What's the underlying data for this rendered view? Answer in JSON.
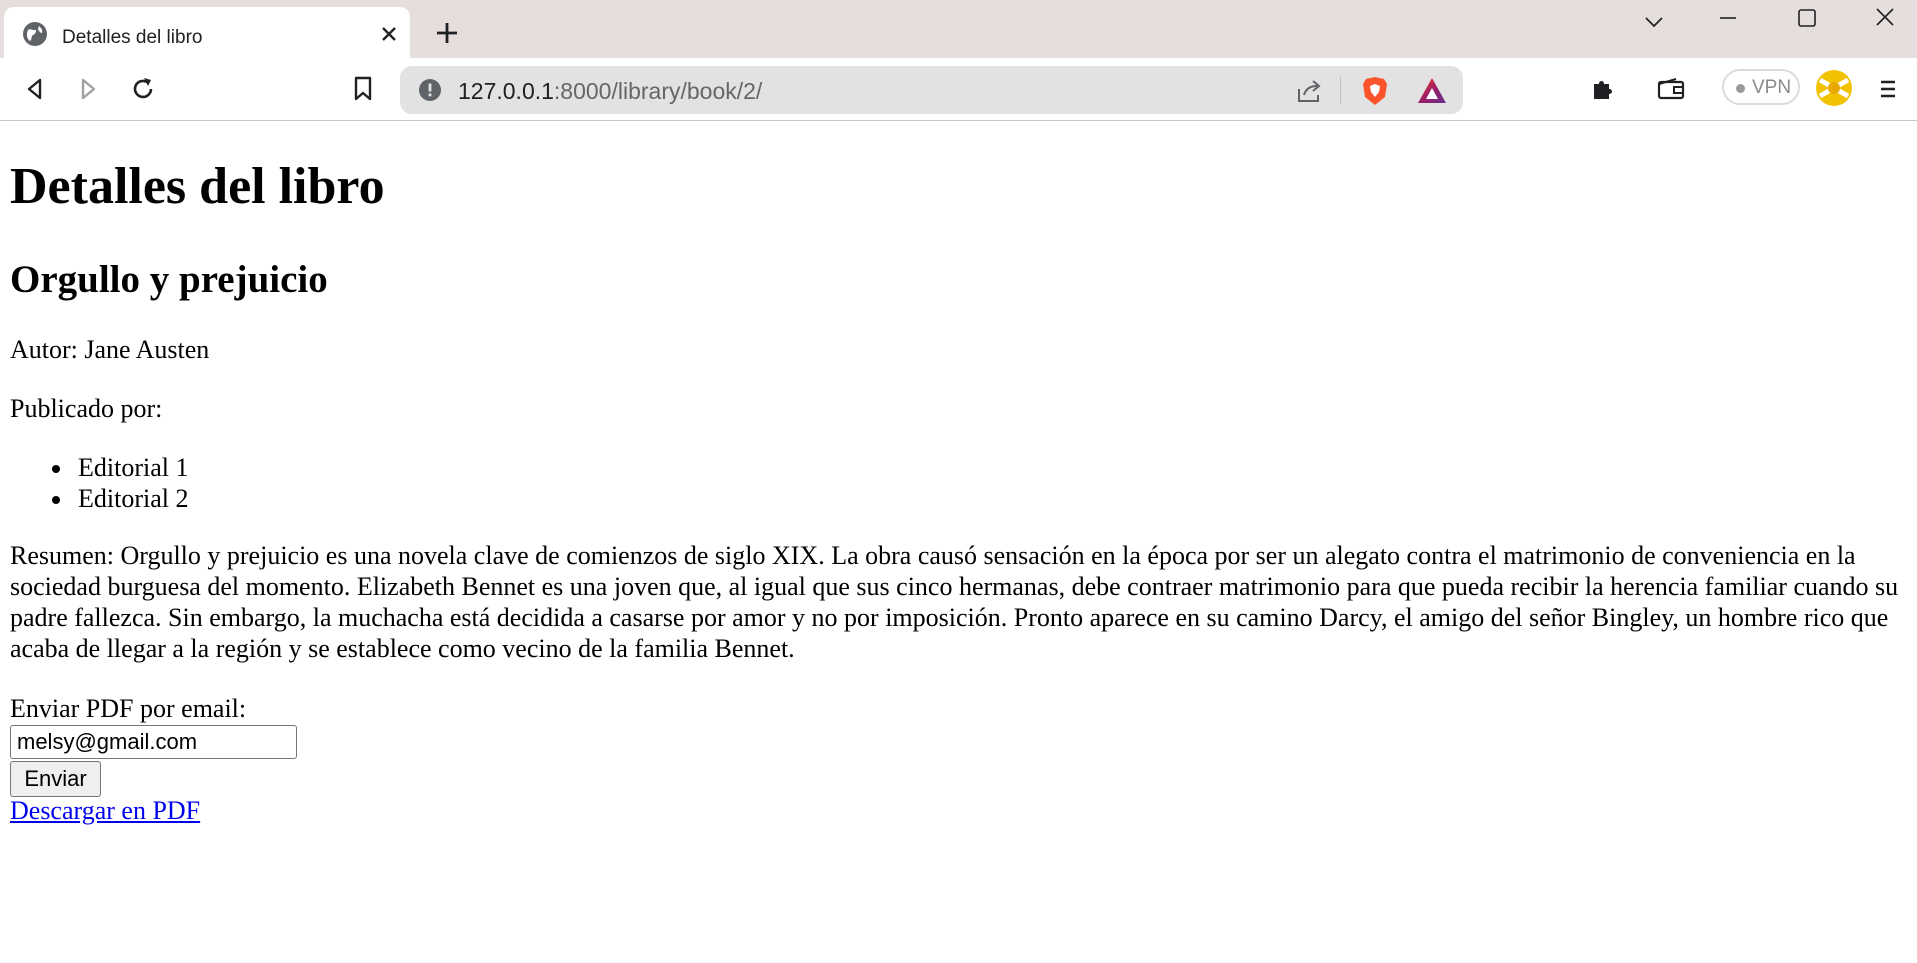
{
  "browser": {
    "tab": {
      "title": "Detalles del libro",
      "favicon": "globe-icon"
    },
    "address_bar": {
      "host": "127.0.0.1",
      "path": ":8000/library/book/2/"
    },
    "vpn_label": "VPN",
    "colors": {
      "tabbar": "#e5dedd",
      "omnibox": "#e2e2e2",
      "brave": "#fb542b"
    }
  },
  "page": {
    "heading": "Detalles del libro",
    "book_title": "Orgullo y prejuicio",
    "author_line": "Autor: Jane Austen",
    "publishers_label": "Publicado por:",
    "publishers": [
      "Editorial 1",
      "Editorial 2"
    ],
    "summary": "Resumen: Orgullo y prejuicio es una novela clave de comienzos de siglo XIX. La obra causó sensación en la época por ser un alegato contra el matrimonio de conveniencia en la sociedad burguesa del momento. Elizabeth Bennet es una joven que, al igual que sus cinco hermanas, debe contraer matrimonio para que pueda recibir la herencia familiar cuando su padre fallezca. Sin embargo, la muchacha está decidida a casarse por amor y no por imposición. Pronto aparece en su camino Darcy, el amigo del señor Bingley, un hombre rico que acaba de llegar a la región y se establece como vecino de la familia Bennet.",
    "email_label": "Enviar PDF por email:",
    "email_value": "melsy@gmail.com",
    "send_button": "Enviar",
    "pdf_link": "Descargar en PDF",
    "link_color": "#0000ee"
  }
}
